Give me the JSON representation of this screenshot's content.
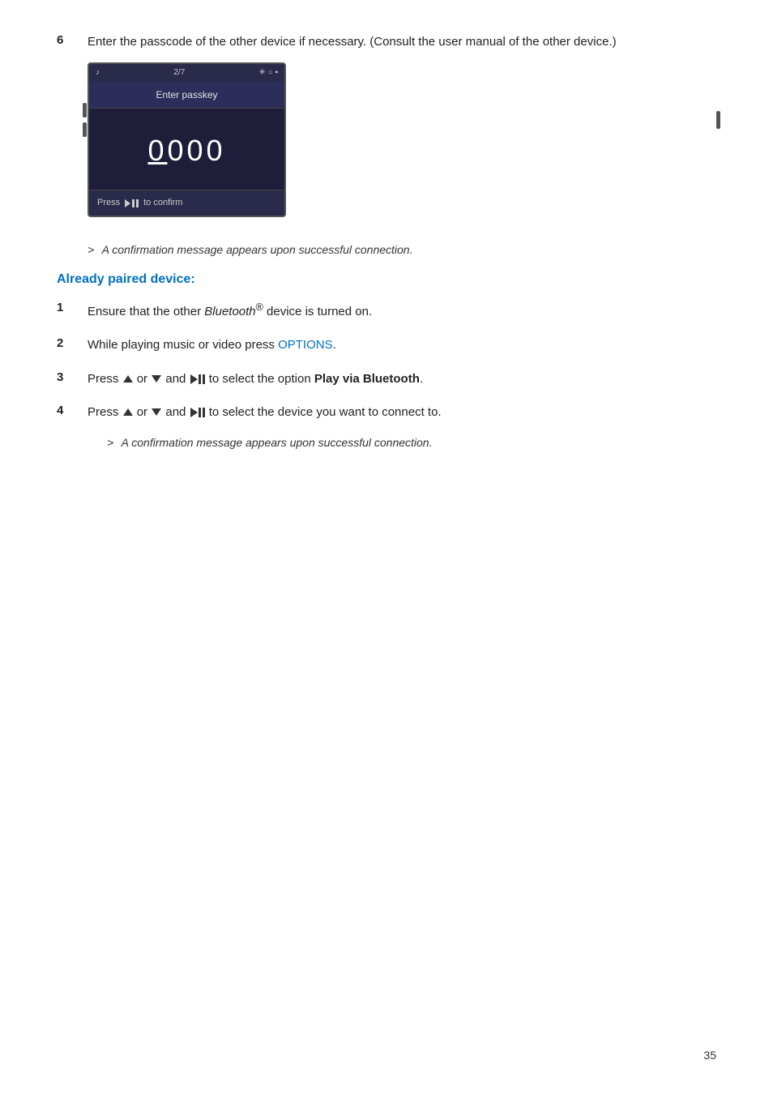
{
  "page": {
    "number": "35"
  },
  "step6": {
    "number": "6",
    "text": "Enter the passcode of the other device if necessary. (Consult the user manual of the other device.)"
  },
  "device": {
    "status_bar": {
      "icon_music": "♪",
      "page_indicator": "2/7",
      "icons_right": "✳○▪"
    },
    "title": "Enter passkey",
    "passkey_value": "0000",
    "footer_text": "to confirm",
    "press_label": "Press"
  },
  "confirmation1": {
    "text": "A confirmation message appears upon successful connection."
  },
  "section_heading": "Already paired device:",
  "steps": [
    {
      "number": "1",
      "text_before": "Ensure that the other ",
      "italic_part": "Bluetooth",
      "superscript": "®",
      "text_after": " device is turned on."
    },
    {
      "number": "2",
      "text_before": "While playing music or video press ",
      "highlight": "OPTIONS",
      "text_after": "."
    },
    {
      "number": "3",
      "text_before": "Press ",
      "nav1": "▲",
      "or1": " or ",
      "nav2": "▼",
      "and": " and ",
      "play_pause": "▶II",
      "text_mid": " to select the option ",
      "bold_part": "Play via Bluetooth",
      "text_after": "."
    },
    {
      "number": "4",
      "text_before": "Press ",
      "nav1": "▲",
      "or1": " or ",
      "nav2": "▼",
      "and": " and ",
      "play_pause": "▶II",
      "text_mid": " to select the device you want to connect to."
    }
  ],
  "confirmation2": {
    "text": "A confirmation message appears upon successful connection."
  }
}
